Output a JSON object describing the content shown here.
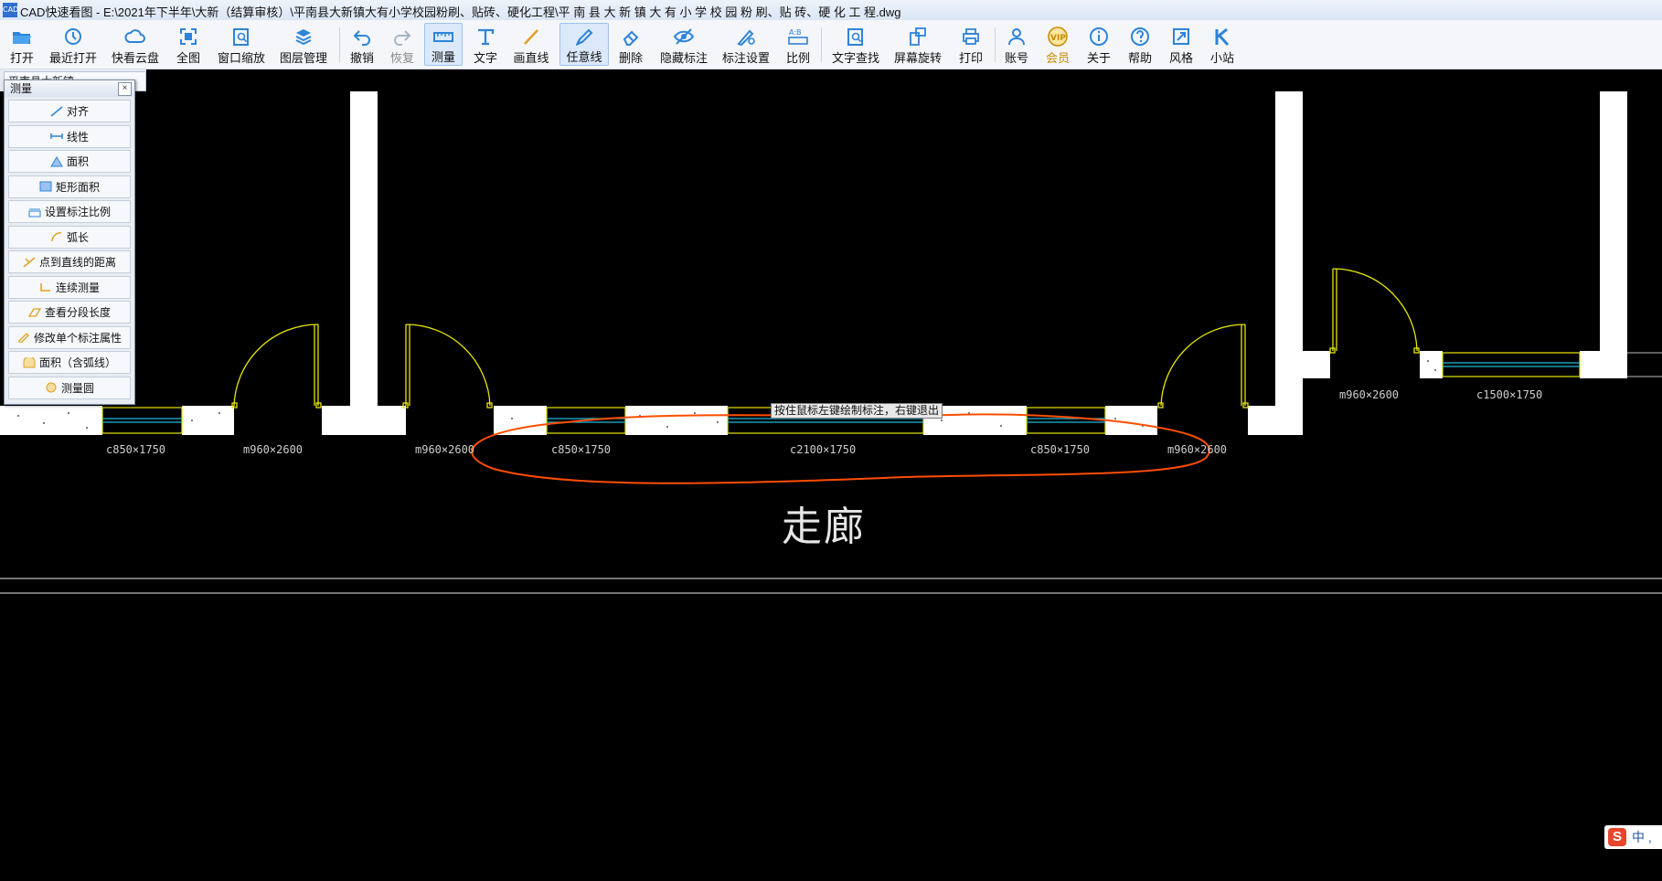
{
  "window": {
    "title": "CAD快速看图 - E:\\2021年下半年\\大新（结算审核）\\平南县大新镇大有小学校园粉刷、贴砖、硬化工程\\平 南 县 大 新 镇 大 有 小 学 校 园 粉 刷、贴 砖、硬 化 工 程.dwg",
    "app_icon_text": "CAD"
  },
  "toolbar": {
    "buttons": [
      {
        "label": "打开",
        "icon": "folder-open-icon"
      },
      {
        "label": "最近打开",
        "icon": "recent-clock-icon"
      },
      {
        "label": "快看云盘",
        "icon": "cloud-icon"
      },
      {
        "label": "全图",
        "icon": "full-view-icon"
      },
      {
        "label": "窗口缩放",
        "icon": "window-zoom-icon"
      },
      {
        "label": "图层管理",
        "icon": "layers-icon"
      },
      {
        "label": "撤销",
        "icon": "undo-icon"
      },
      {
        "label": "恢复",
        "icon": "redo-icon"
      },
      {
        "label": "测量",
        "icon": "measure-icon"
      },
      {
        "label": "文字",
        "icon": "text-icon"
      },
      {
        "label": "画直线",
        "icon": "line-icon"
      },
      {
        "label": "任意线",
        "icon": "freehand-icon"
      },
      {
        "label": "删除",
        "icon": "eraser-icon"
      },
      {
        "label": "隐藏标注",
        "icon": "hide-eye-icon"
      },
      {
        "label": "标注设置",
        "icon": "annotation-settings-icon"
      },
      {
        "label": "比例",
        "icon": "scale-icon"
      },
      {
        "label": "文字查找",
        "icon": "text-search-icon"
      },
      {
        "label": "屏幕旋转",
        "icon": "rotate-screen-icon"
      },
      {
        "label": "打印",
        "icon": "printer-icon"
      },
      {
        "label": "账号",
        "icon": "user-icon"
      },
      {
        "label": "会员",
        "icon": "vip-icon"
      },
      {
        "label": "关于",
        "icon": "info-icon"
      },
      {
        "label": "帮助",
        "icon": "help-icon"
      },
      {
        "label": "风格",
        "icon": "style-icon"
      },
      {
        "label": "小站",
        "icon": "k-site-icon"
      }
    ]
  },
  "document_tab": {
    "label": "平南县大新镇..."
  },
  "measure_panel": {
    "title": "测量",
    "close_symbol": "×",
    "items": [
      {
        "label": "对齐"
      },
      {
        "label": "线性"
      },
      {
        "label": "面积"
      },
      {
        "label": "矩形面积"
      },
      {
        "label": "设置标注比例"
      },
      {
        "label": "弧长"
      },
      {
        "label": "点到直线的距离"
      },
      {
        "label": "连续测量"
      },
      {
        "label": "查看分段长度"
      },
      {
        "label": "修改单个标注属性"
      },
      {
        "label": "面积（含弧线）"
      },
      {
        "label": "测量圆"
      }
    ]
  },
  "drawing": {
    "labels": [
      "c850×1750",
      "m960×2600",
      "m960×2600",
      "c850×1750",
      "c2100×1750",
      "c850×1750",
      "m960×2600",
      "m960×2600",
      "c1500×1750"
    ],
    "room_label": "走廊",
    "hint": "按住鼠标左键绘制标注，右键退出",
    "colors": {
      "wall": "#ffffff",
      "door": "#e6e600",
      "window": "#1fb8d8",
      "markup": "#ff4d00",
      "background": "#000000"
    }
  },
  "ime": {
    "logo": "S",
    "text": "中 ,"
  }
}
